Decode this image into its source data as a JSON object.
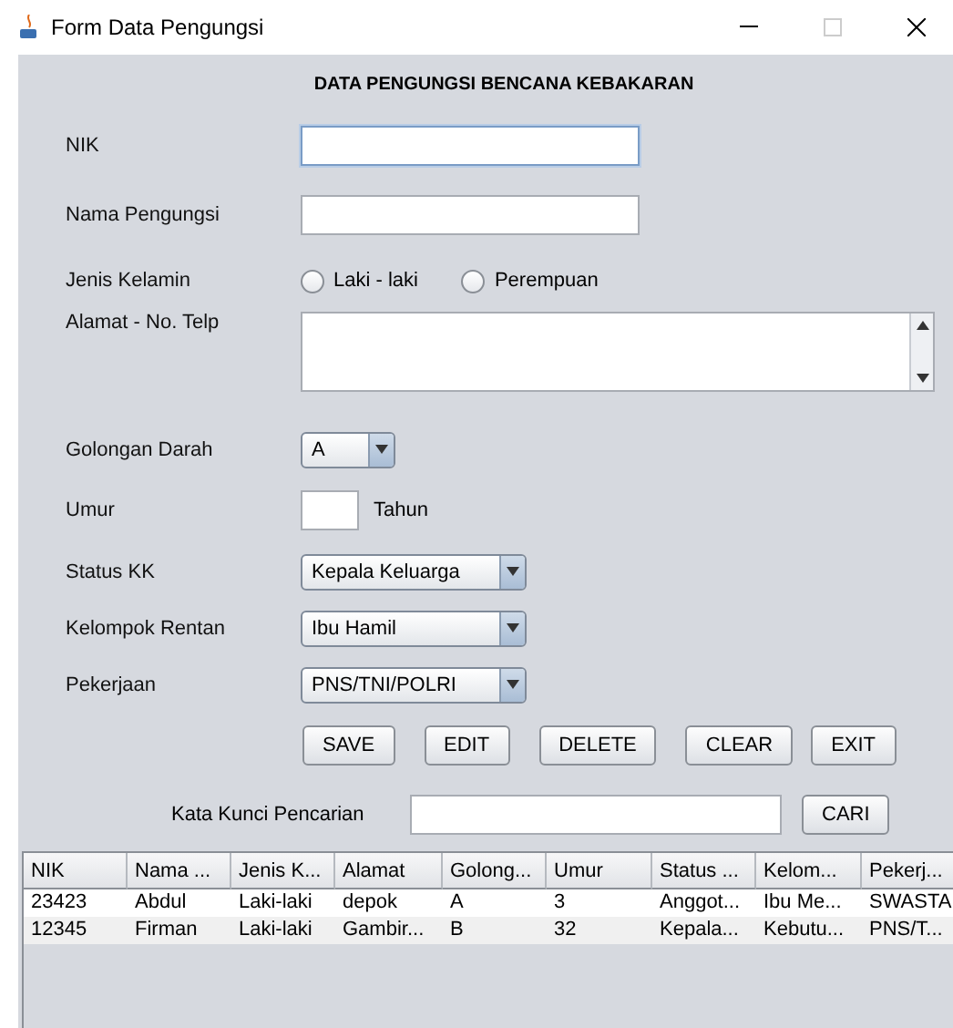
{
  "window": {
    "title": "Form Data Pengungsi"
  },
  "heading": "DATA PENGUNGSI BENCANA KEBAKARAN",
  "fields": [
    {
      "kind": "text",
      "label": "NIK",
      "focused": true
    },
    {
      "kind": "text",
      "label": "Nama Pengungsi",
      "focused": false
    },
    {
      "kind": "radio",
      "label": "Jenis Kelamin",
      "options": [
        {
          "label": "Laki - laki",
          "selected": false
        },
        {
          "label": "Perempuan",
          "selected": false
        }
      ]
    },
    {
      "kind": "textarea",
      "label": "Alamat - No. Telp"
    },
    {
      "kind": "select",
      "label": "Golongan Darah",
      "value": "A"
    },
    {
      "kind": "number",
      "label": "Umur",
      "unit": "Tahun"
    },
    {
      "kind": "select",
      "label": "Status KK",
      "value": "Kepala Keluarga"
    },
    {
      "kind": "select",
      "label": "Kelompok Rentan",
      "value": "Ibu Hamil"
    },
    {
      "kind": "select",
      "label": "Pekerjaan",
      "value": "PNS/TNI/POLRI"
    }
  ],
  "buttons": [
    "SAVE",
    "EDIT",
    "DELETE",
    "CLEAR",
    "EXIT"
  ],
  "search": {
    "label": "Kata Kunci Pencarian",
    "button": "CARI"
  },
  "table": {
    "columns": [
      "NIK",
      "Nama ...",
      "Jenis K...",
      "Alamat",
      "Golong...",
      "Umur",
      "Status ...",
      "Kelom...",
      "Pekerj..."
    ],
    "rows": [
      [
        "23423",
        "Abdul",
        "Laki-laki",
        "depok",
        "A",
        "3",
        "Anggot...",
        "Ibu Me...",
        "SWASTA"
      ],
      [
        "12345",
        "Firman",
        "Laki-laki",
        "Gambir...",
        "B",
        "32",
        "Kepala...",
        "Kebutu...",
        "PNS/T..."
      ]
    ]
  }
}
